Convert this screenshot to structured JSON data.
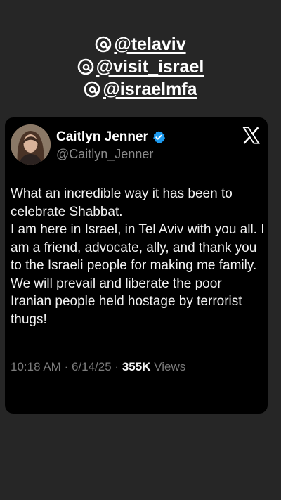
{
  "mentions": [
    "@telaviv",
    "@visit_israel",
    "@israelmfa"
  ],
  "tweet": {
    "author_name": "Caitlyn Jenner",
    "handle": "@Caitlyn_Jenner",
    "paragraph1": "What an incredible way it has been to celebrate Shabbat.",
    "paragraph2": "I am here in Israel, in Tel Aviv with you all. I am a friend, advocate, ally, and thank you to the Israeli people for making me family. We will prevail and liberate the poor Iranian people held hostage by terrorist thugs!",
    "time": "10:18 AM",
    "date": "6/14/25",
    "views_count": "355K",
    "views_label": "Views"
  },
  "icons": {
    "mention": "threads-icon",
    "verified": "verified-badge-icon",
    "platform": "x-logo-icon"
  },
  "colors": {
    "background": "#262626",
    "card": "#000000",
    "verified": "#1d9bf0",
    "muted": "#7c7c7c"
  }
}
